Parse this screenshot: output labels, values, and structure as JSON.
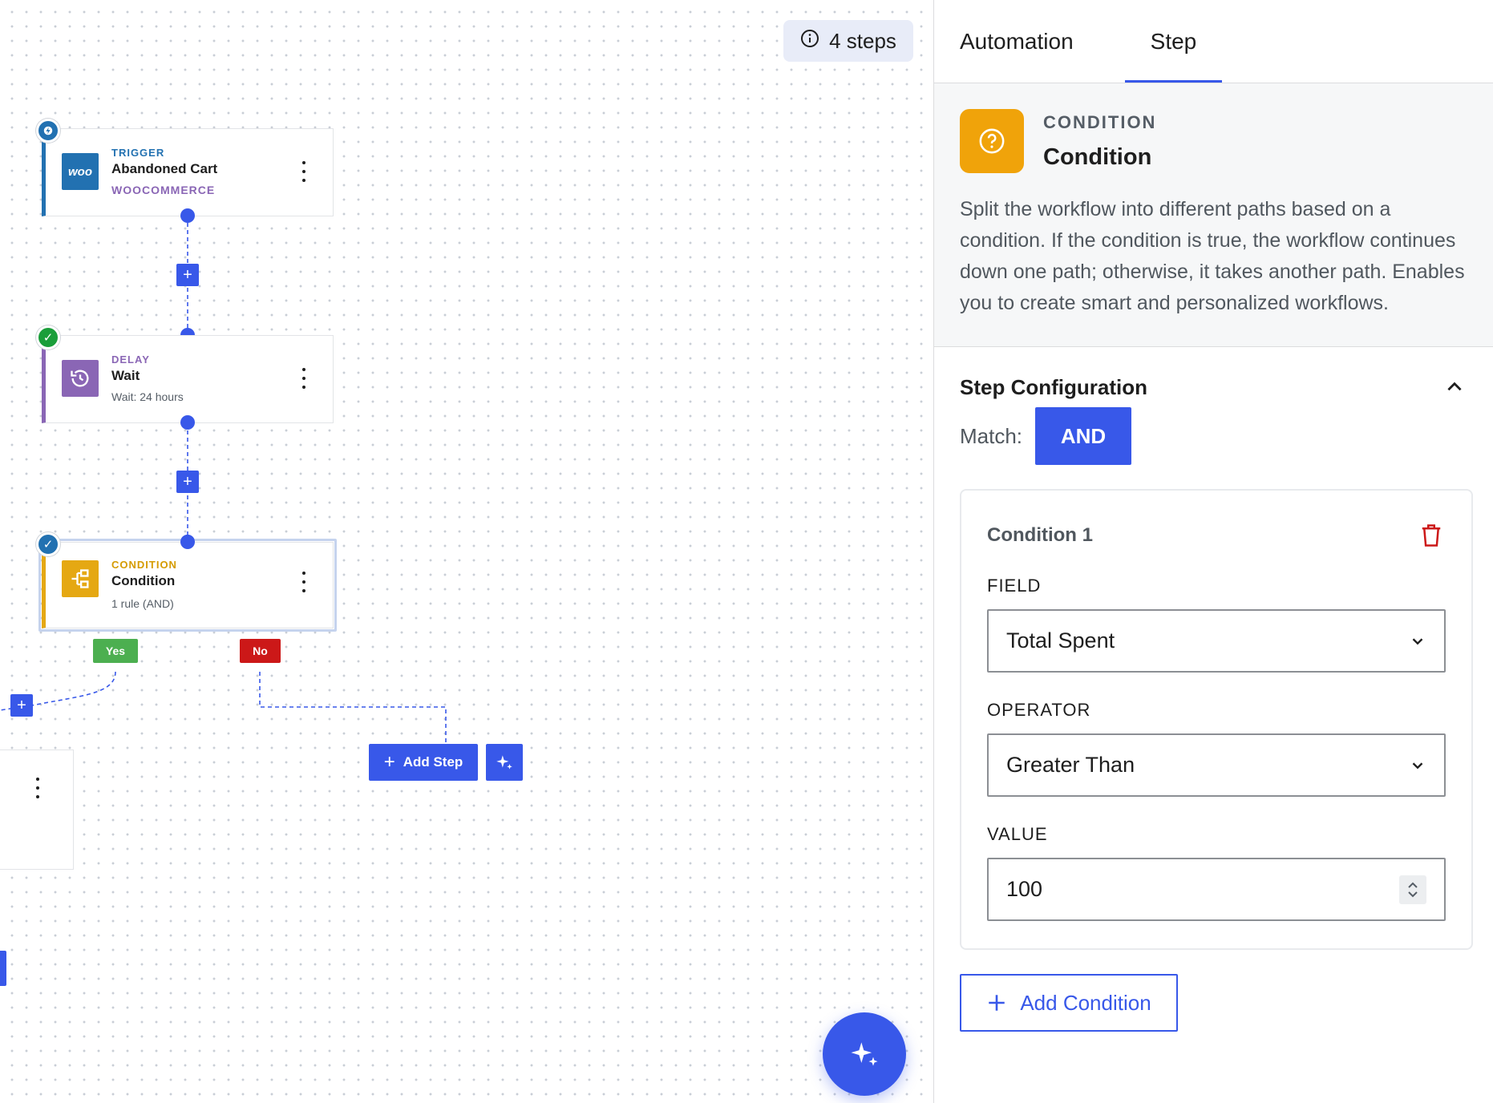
{
  "canvas": {
    "steps_count": "4 steps",
    "nodes": [
      {
        "kicker": "TRIGGER",
        "title": "Abandoned Cart",
        "sub": "WOOCOMMERCE",
        "icon": "woocommerce-icon",
        "icon_text": "woo",
        "accent": "#2271b1",
        "kicker_color": "#2271b1",
        "status": "bolt-icon"
      },
      {
        "kicker": "DELAY",
        "title": "Wait",
        "sub": "Wait: 24 hours",
        "icon": "history-icon",
        "accent": "#8a66b5",
        "kicker_color": "#8a66b5",
        "status": "check-icon"
      },
      {
        "kicker": "CONDITION",
        "title": "Condition",
        "sub": "1 rule (AND)",
        "icon": "branch-icon",
        "accent": "#e5a813",
        "kicker_color": "#d59b00",
        "status": "check-icon"
      }
    ],
    "branches": {
      "yes": "Yes",
      "no": "No",
      "yes_color": "#4caf50",
      "no_color": "#cc1818"
    },
    "add_step_label": "Add Step",
    "accent": "#3858e9"
  },
  "panel": {
    "tabs": [
      {
        "label": "Automation"
      },
      {
        "label": "Step"
      }
    ],
    "active_tab": "Step",
    "info": {
      "kicker": "CONDITION",
      "title": "Condition",
      "description": "Split the workflow into different paths based on a condition. If the condition is true, the workflow continues down one path; otherwise, it takes another path. Enables you to create smart and personalized workflows.",
      "icon": "question-circle-icon",
      "icon_color": "#f0a30a"
    },
    "config": {
      "title": "Step Configuration",
      "match_label": "Match:",
      "match_value": "AND",
      "conditions": [
        {
          "name": "Condition 1",
          "field_label": "FIELD",
          "field_value": "Total Spent",
          "operator_label": "OPERATOR",
          "operator_value": "Greater Than",
          "value_label": "VALUE",
          "value": "100"
        }
      ],
      "add_condition_label": "Add Condition"
    }
  }
}
